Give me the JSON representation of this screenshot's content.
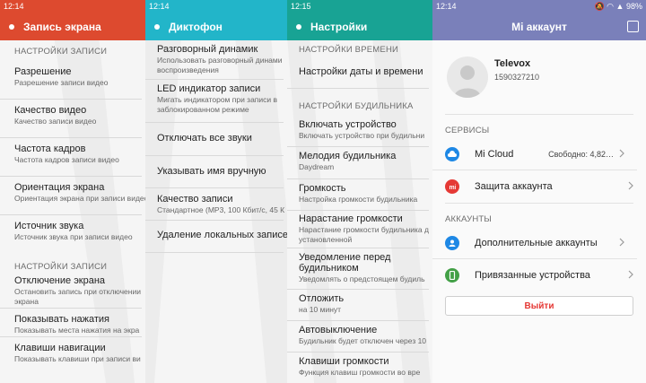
{
  "panel1": {
    "status_time": "12:14",
    "title": "Запись экрана",
    "section1": "НАСТРОЙКИ ЗАПИСИ",
    "items1": [
      {
        "title": "Разрешение",
        "subtitle": "Разрешение записи видео"
      },
      {
        "title": "Качество видео",
        "subtitle": "Качество записи видео"
      },
      {
        "title": "Частота кадров",
        "subtitle": "Частота кадров записи видео"
      },
      {
        "title": "Ориентация экрана",
        "subtitle": "Ориентация экрана при записи видео"
      },
      {
        "title": "Источник звука",
        "subtitle": "Источник звука при записи видео"
      }
    ],
    "section2": "НАСТРОЙКИ ЗАПИСИ",
    "items2": [
      {
        "title": "Отключение экрана",
        "subtitle": "Остановить запись при отключении",
        "subtitle2": "экрана"
      },
      {
        "title": "Показывать нажатия",
        "subtitle": "Показывать места нажатия на экра"
      },
      {
        "title": "Клавиши навигации",
        "subtitle": "Показывать клавиши при записи ви"
      }
    ]
  },
  "panel2": {
    "status_time": "12:14",
    "title": "Диктофон",
    "items": [
      {
        "title": "Разговорный динамик",
        "subtitle": "Использовать разговорный динами",
        "subtitle2": "воспроизведения"
      },
      {
        "title": "LED индикатор записи",
        "subtitle": "Мигать индикатором при записи в",
        "subtitle2": "заблокированном режиме"
      },
      {
        "title": "Отключать все звуки",
        "subtitle": ""
      },
      {
        "title": "Указывать имя вручную",
        "subtitle": ""
      },
      {
        "title": "Качество записи",
        "subtitle": "Стандартное (MP3, 100 Кбит/с, 45 К"
      },
      {
        "title": "Удаление локальных записей",
        "subtitle": ""
      }
    ]
  },
  "panel3": {
    "status_time": "12:15",
    "title": "Настройки",
    "section1": "НАСТРОЙКИ ВРЕМЕНИ",
    "item_time": {
      "title": "Настройки даты и времени"
    },
    "section2": "НАСТРОЙКИ БУДИЛЬНИКА",
    "items": [
      {
        "title": "Включать устройство",
        "subtitle": "Включать устройство при будильни"
      },
      {
        "title": "Мелодия будильника",
        "subtitle": "Daydream"
      },
      {
        "title": "Громкость",
        "subtitle": "Настройка громкости будильника"
      },
      {
        "title": "Нарастание громкости",
        "subtitle": "Нарастание громкости будильника д",
        "subtitle2": "установленной"
      },
      {
        "title": "Уведомление перед",
        "title2": "будильником",
        "subtitle": "Уведомлять о предстоящем будиль"
      },
      {
        "title": "Отложить",
        "subtitle": "на 10 минут"
      },
      {
        "title": "Автовыключение",
        "subtitle": "Будильник будет отключен через 10"
      },
      {
        "title": "Клавиши громкости",
        "subtitle": "Функция клавиш громкости во вре"
      }
    ]
  },
  "panel4": {
    "status_time": "12:14",
    "battery": "98%",
    "title": "Mi аккаунт",
    "profile_name": "Televox",
    "profile_id": "1590327210",
    "section_services": "СЕРВИСЫ",
    "mi_cloud": "Mi Cloud",
    "mi_cloud_value": "Свободно: 4,82…",
    "protection": "Защита аккаунта",
    "section_accounts": "АККАУНТЫ",
    "additional_accounts": "Дополнительные аккаунты",
    "linked_devices": "Привязанные устройства",
    "logout": "Выйти"
  },
  "colors": {
    "panel1": "#dd4a2f",
    "panel2": "#22b5c9",
    "panel3": "#18a394",
    "panel4": "#7a80ba",
    "mi_cloud_icon": "#1e88e5",
    "protection_icon": "#e53935",
    "additional_icon": "#1e88e5",
    "linked_icon": "#43a047"
  }
}
